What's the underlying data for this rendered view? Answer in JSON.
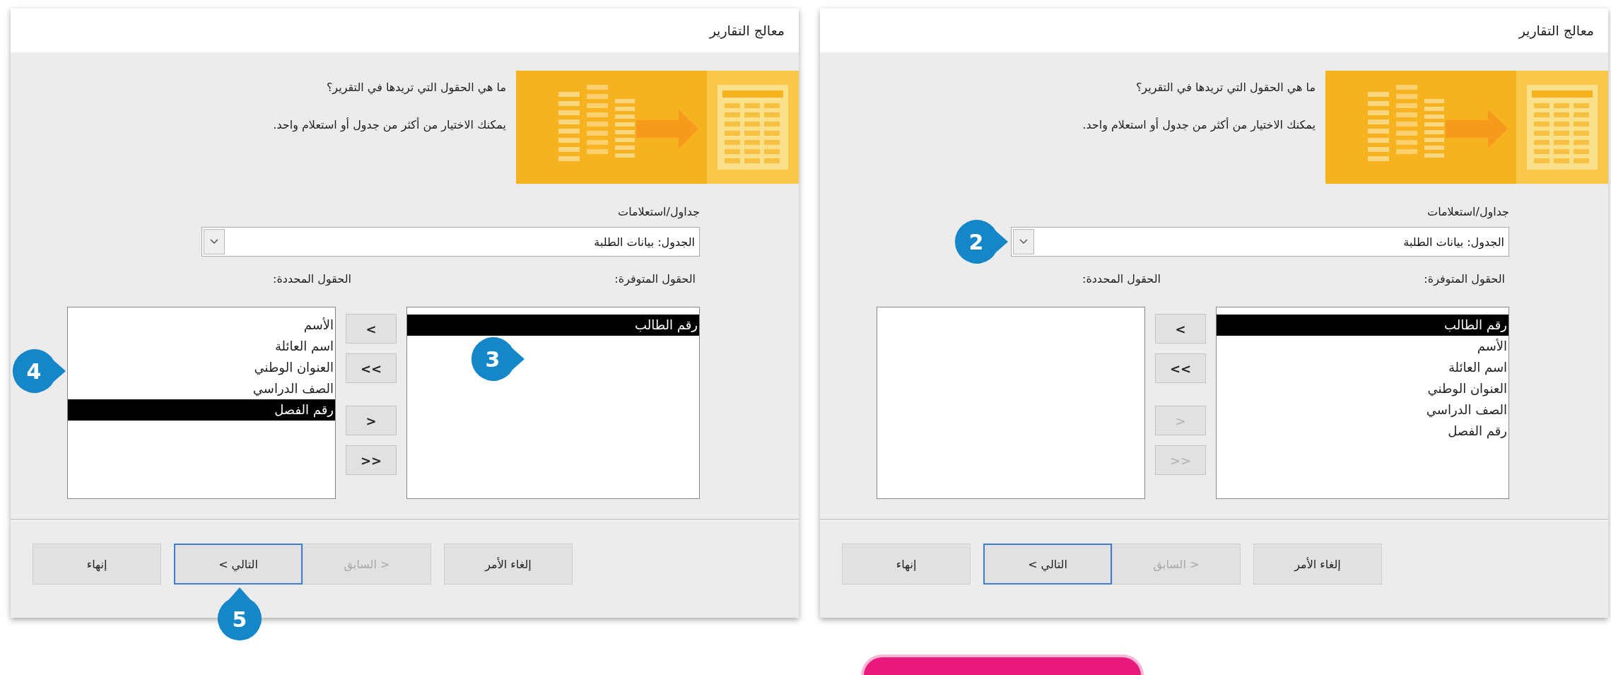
{
  "dialogs": [
    {
      "title": "معالج التقارير",
      "question": "ما هي الحقول التي تريدها في التقرير؟",
      "hint": "يمكنك الاختيار من أكثر من جدول أو استعلام واحد.",
      "source_label": "جداول/استعلامات",
      "source_value": "الجدول: بيانات الطلبة",
      "available_label": "الحقول المتوفرة:",
      "selected_label": "الحقول المحددة:",
      "available_fields": [
        {
          "label": "رقم الطالب",
          "selected": true
        },
        {
          "label": "الأسم",
          "selected": false
        },
        {
          "label": "اسم العائلة",
          "selected": false
        },
        {
          "label": "العنوان الوطني",
          "selected": false
        },
        {
          "label": "الصف الدراسي",
          "selected": false
        },
        {
          "label": "رقم الفصل",
          "selected": false
        }
      ],
      "move_buttons": [
        {
          "label": "<",
          "disabled": false
        },
        {
          "label": "<<",
          "disabled": false
        },
        {
          "label": ">",
          "disabled": true
        },
        {
          "label": ">>",
          "disabled": true
        }
      ],
      "footer_buttons": [
        {
          "label": "إلغاء الأمر",
          "disabled": false,
          "focused": false
        },
        {
          "label": "< السابق",
          "disabled": true,
          "focused": false
        },
        {
          "label": "التالي >",
          "disabled": false,
          "focused": true
        },
        {
          "label": "إنهاء",
          "disabled": false,
          "focused": false
        }
      ],
      "combo_callout": "2"
    },
    {
      "title": "معالج التقارير",
      "question": "ما هي الحقول التي تريدها في التقرير؟",
      "hint": "يمكنك الاختيار من أكثر من جدول أو استعلام واحد.",
      "source_label": "جداول/استعلامات",
      "source_value": "الجدول: بيانات الطلبة",
      "available_label": "الحقول المتوفرة:",
      "selected_label": "الحقول المحددة:",
      "available_fields": [
        {
          "label": "رقم الطالب",
          "selected": true
        }
      ],
      "selected_fields": [
        {
          "label": "الأسم",
          "selected": false
        },
        {
          "label": "اسم العائلة",
          "selected": false
        },
        {
          "label": "العنوان الوطني",
          "selected": false
        },
        {
          "label": "الصف الدراسي",
          "selected": false
        },
        {
          "label": "رقم الفصل",
          "selected": true
        }
      ],
      "move_buttons": [
        {
          "label": "<",
          "disabled": false
        },
        {
          "label": "<<",
          "disabled": false
        },
        {
          "label": ">",
          "disabled": false
        },
        {
          "label": ">>",
          "disabled": false
        }
      ],
      "footer_buttons": [
        {
          "label": "إلغاء الأمر",
          "disabled": false,
          "focused": false
        },
        {
          "label": "< السابق",
          "disabled": true,
          "focused": false
        },
        {
          "label": "التالي >",
          "disabled": false,
          "focused": true
        },
        {
          "label": "إنهاء",
          "disabled": false,
          "focused": false
        }
      ],
      "available_callout": "3",
      "selected_callout": "4",
      "next_callout": "5"
    }
  ]
}
